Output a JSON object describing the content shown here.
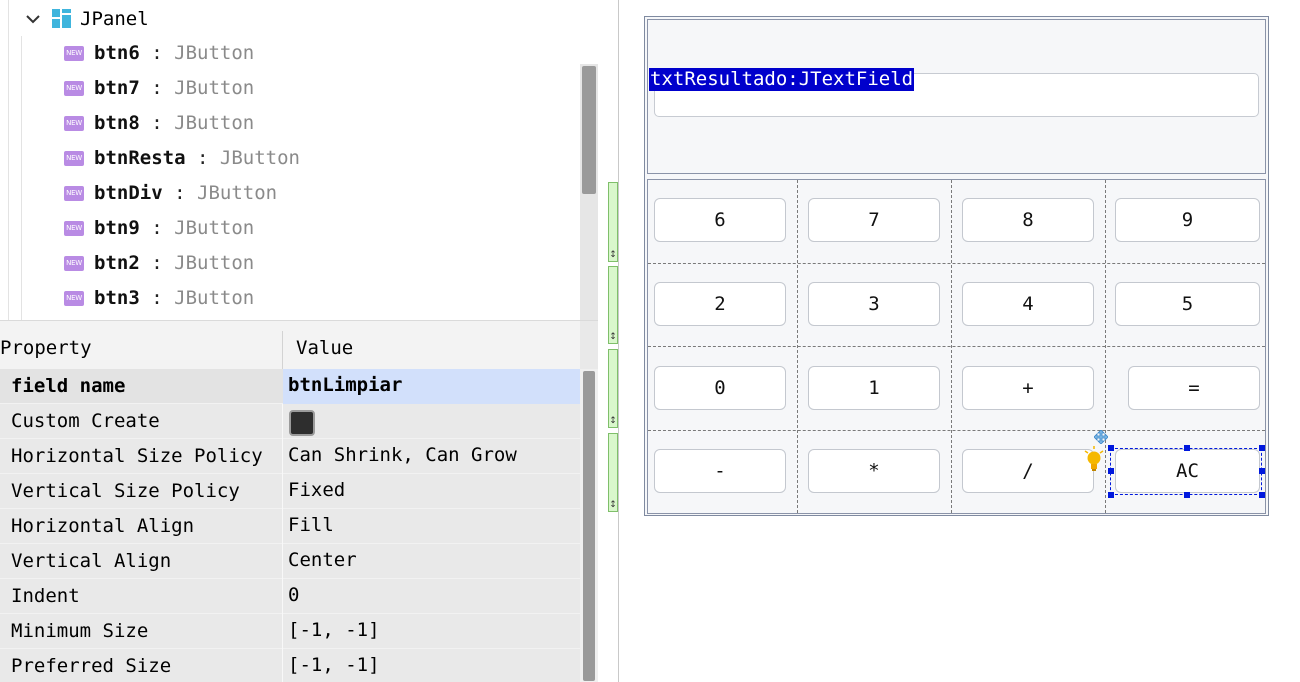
{
  "tree": {
    "root_label": "JPanel",
    "badge_text": "NEW",
    "items": [
      {
        "name": "btn6",
        "type": "JButton"
      },
      {
        "name": "btn7",
        "type": "JButton"
      },
      {
        "name": "btn8",
        "type": "JButton"
      },
      {
        "name": "btnResta",
        "type": "JButton"
      },
      {
        "name": "btnDiv",
        "type": "JButton"
      },
      {
        "name": "btn9",
        "type": "JButton"
      },
      {
        "name": "btn2",
        "type": "JButton"
      },
      {
        "name": "btn3",
        "type": "JButton"
      }
    ],
    "separator": ":"
  },
  "properties": {
    "header_property": "Property",
    "header_value": "Value",
    "rows": [
      {
        "key": "field name",
        "value": "btnLimpiar"
      },
      {
        "key": "Custom Create",
        "value": ""
      },
      {
        "key": "Horizontal Size Policy",
        "value": "Can Shrink, Can Grow"
      },
      {
        "key": "Vertical Size Policy",
        "value": "Fixed"
      },
      {
        "key": "Horizontal Align",
        "value": "Fill"
      },
      {
        "key": "Vertical Align",
        "value": "Center"
      },
      {
        "key": "Indent",
        "value": "0"
      },
      {
        "key": "Minimum Size",
        "value": "[-1, -1]"
      },
      {
        "key": "Preferred Size",
        "value": "[-1, -1]"
      }
    ]
  },
  "designer": {
    "textfield_label": "txtResultado:JTextField",
    "buttons": [
      [
        "6",
        "7",
        "8",
        "9"
      ],
      [
        "2",
        "3",
        "4",
        "5"
      ],
      [
        "0",
        "1",
        "+",
        "="
      ],
      [
        "-",
        "*",
        "/",
        "AC"
      ]
    ],
    "row_handle_glyph": "↕",
    "colors": {
      "selection": "#0000cc",
      "badge": "#b98be4",
      "row_handle": "#d9f7cc",
      "panel_icon": "#3fb5dd",
      "bulb": "#f5b800"
    }
  }
}
